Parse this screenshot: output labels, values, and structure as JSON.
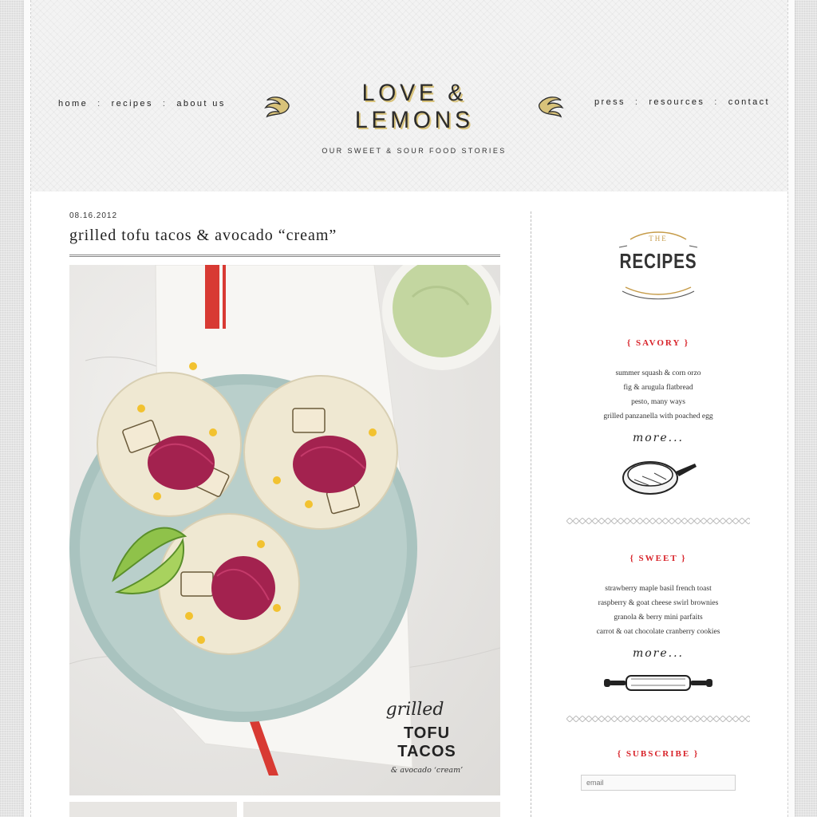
{
  "nav": {
    "left": [
      "home",
      "recipes",
      "about us"
    ],
    "right": [
      "press",
      "resources",
      "contact"
    ],
    "separator": ":"
  },
  "logo": {
    "title": "LOVE & LEMONS",
    "tagline": "OUR SWEET & SOUR FOOD STORIES"
  },
  "post": {
    "date": "08.16.2012",
    "title": "grilled tofu tacos & avocado “cream”",
    "overlay": {
      "script": "grilled",
      "main": "TOFU TACOS",
      "sub": "& avocado ‘cream’"
    }
  },
  "sidebar": {
    "badge_top": "THE",
    "badge_main": "RECIPES",
    "savory": {
      "heading": "{ SAVORY }",
      "items": [
        "summer squash & corn orzo",
        "fig & arugula flatbread",
        "pesto, many ways",
        "grilled panzanella with poached egg"
      ],
      "more": "more..."
    },
    "sweet": {
      "heading": "{ SWEET }",
      "items": [
        "strawberry maple basil french toast",
        "raspberry & goat cheese swirl brownies",
        "granola & berry mini parfaits",
        "carrot & oat chocolate cranberry cookies"
      ],
      "more": "more..."
    },
    "subscribe": {
      "heading": "{ SUBSCRIBE }",
      "placeholder": "email"
    }
  },
  "colors": {
    "accent_red": "#d8232a",
    "logo_gold": "#d8c27a",
    "plate": "#b9cfcb",
    "avocado_cream": "#c3d6a0",
    "cabbage": "#a3224f"
  }
}
